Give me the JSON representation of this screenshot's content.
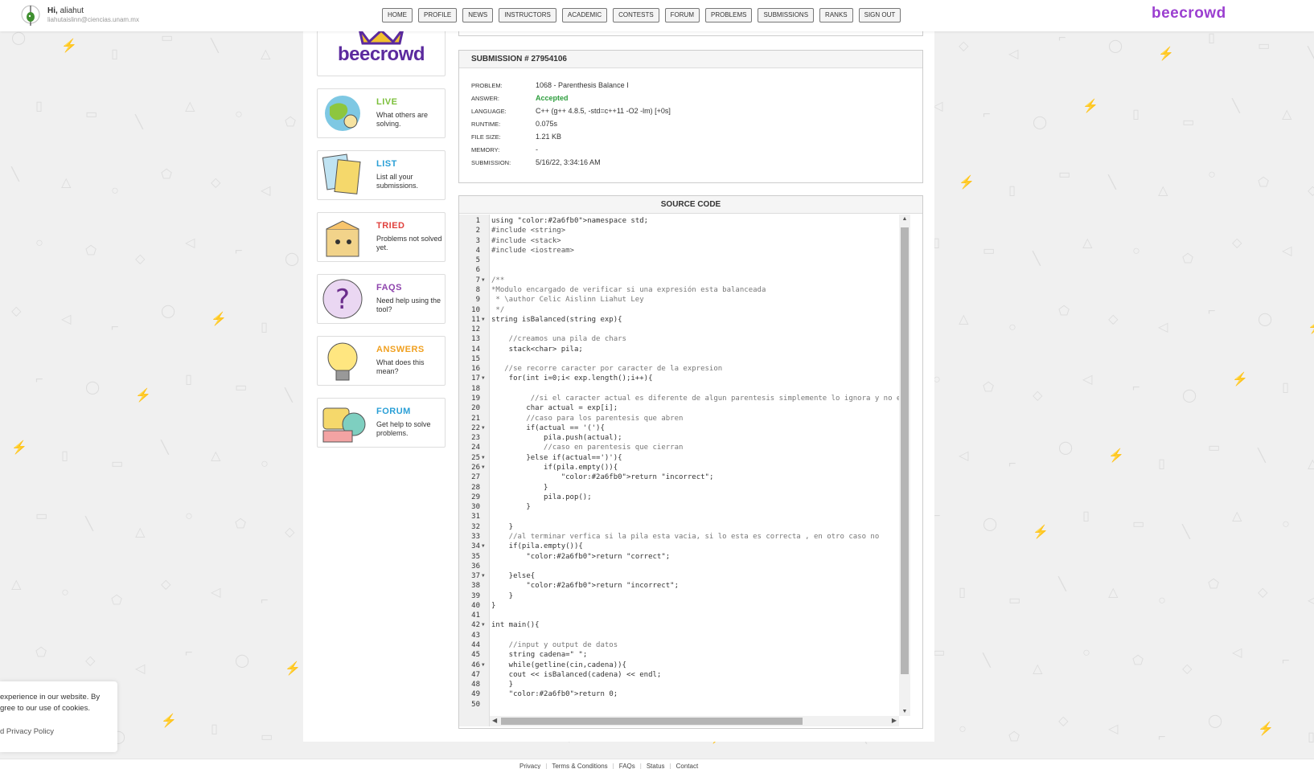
{
  "user": {
    "greeting": "Hi,",
    "name": "aliahut",
    "email": "liahutaislinn@ciencias.unam.mx"
  },
  "nav": [
    "HOME",
    "PROFILE",
    "NEWS",
    "INSTRUCTORS",
    "ACADEMIC",
    "CONTESTS",
    "FORUM",
    "PROBLEMS",
    "SUBMISSIONS",
    "RANKS",
    "SIGN OUT"
  ],
  "brand": "beecrowd",
  "sidebar": {
    "logo_text": "beecrowd",
    "items": [
      {
        "title": "LIVE",
        "desc": "What others are solving.",
        "color": "#7bbf3a",
        "icon": "globe-icon"
      },
      {
        "title": "LIST",
        "desc": "List all your submissions.",
        "color": "#2a9fd6",
        "icon": "documents-icon"
      },
      {
        "title": "TRIED",
        "desc": "Problems not solved yet.",
        "color": "#e0413d",
        "icon": "box-icon"
      },
      {
        "title": "FAQS",
        "desc": "Need help using the tool?",
        "color": "#8e44ad",
        "icon": "question-icon"
      },
      {
        "title": "ANSWERS",
        "desc": "What does this mean?",
        "color": "#f0a020",
        "icon": "lightbulb-icon"
      },
      {
        "title": "FORUM",
        "desc": "Get help to solve problems.",
        "color": "#2a9fd6",
        "icon": "chat-icon"
      }
    ]
  },
  "submission": {
    "title": "SUBMISSION # 27954106",
    "rows": [
      {
        "k": "PROBLEM:",
        "v": "1068 - Parenthesis Balance I"
      },
      {
        "k": "ANSWER:",
        "v": "Accepted"
      },
      {
        "k": "LANGUAGE:",
        "v": "C++ (g++ 4.8.5, -std=c++11 -O2 -lm) [+0s]"
      },
      {
        "k": "RUNTIME:",
        "v": "0.075s"
      },
      {
        "k": "FILE SIZE:",
        "v": "1.21 KB"
      },
      {
        "k": "MEMORY:",
        "v": "-"
      },
      {
        "k": "SUBMISSION:",
        "v": "5/16/22, 3:34:16 AM"
      }
    ],
    "answer_color": "#2e9e3e"
  },
  "source": {
    "title": "SOURCE CODE",
    "lines": [
      "using namespace std;",
      "#include <string>",
      "#include <stack>",
      "#include <iostream>",
      "",
      "",
      "/**",
      "*Modulo encargado de verificar si una expresión esta balanceada",
      " * \\author Celic Aislinn Liahut Ley",
      " */",
      "string isBalanced(string exp){",
      "",
      "    //creamos una pila de chars",
      "    stack<char> pila;",
      "",
      "   //se recorre caracter por caracter de la expresion",
      "    for(int i=0;i< exp.length();i++){",
      "",
      "         //si el caracter actual es diferente de algun parentesis simplemente lo ignora y no entra",
      "        char actual = exp[i];",
      "        //caso para los parentesis que abren",
      "        if(actual == '('){",
      "            pila.push(actual);",
      "            //caso en parentesis que cierran",
      "        }else if(actual==')'){",
      "            if(pila.empty()){",
      "                return \"incorrect\";",
      "            }",
      "            pila.pop();",
      "        }",
      "",
      "    }",
      "    //al terminar verfica si la pila esta vacia, si lo esta es correcta , en otro caso no",
      "    if(pila.empty()){",
      "        return \"correct\";",
      "",
      "    }else{",
      "        return \"incorrect\";",
      "    }",
      "}",
      "",
      "int main(){",
      "",
      "    //input y output de datos",
      "    string cadena=\" \";",
      "    while(getline(cin,cadena)){",
      "    cout << isBalanced(cadena) << endl;",
      "    }",
      "    return 0;",
      ""
    ],
    "folds": [
      7,
      11,
      17,
      22,
      25,
      26,
      34,
      37,
      42,
      46
    ]
  },
  "cookie": {
    "line1": "experience in our website. By",
    "line2": "gree to our use of cookies.",
    "link": "d Privacy Policy"
  },
  "footer": [
    "Privacy",
    "Terms & Conditions",
    "FAQs",
    "Status",
    "Contact"
  ]
}
